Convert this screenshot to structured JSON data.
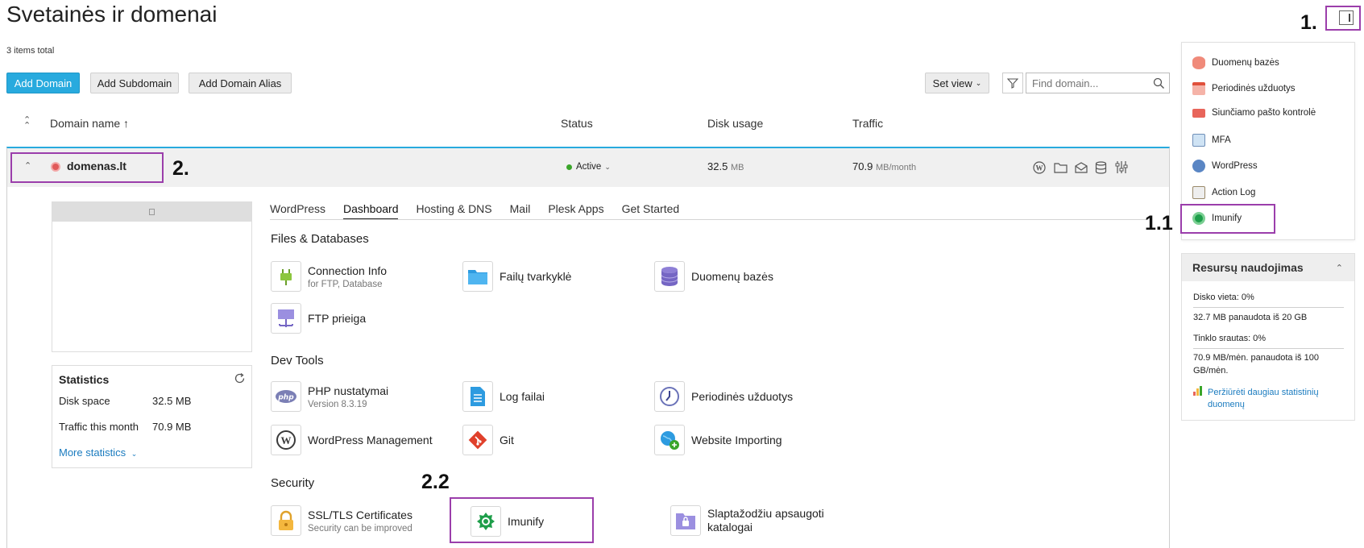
{
  "page": {
    "title": "Svetainės ir domenai",
    "items_total": "3 items total"
  },
  "toolbar": {
    "add_domain": "Add Domain",
    "add_subdomain": "Add Subdomain",
    "add_domain_alias": "Add Domain Alias",
    "set_view": "Set view",
    "search_placeholder": "Find domain..."
  },
  "table": {
    "headers": {
      "domain_name": "Domain name ↑",
      "status": "Status",
      "disk_usage": "Disk usage",
      "traffic": "Traffic"
    },
    "row": {
      "domain": "domenas.lt",
      "status": "Active",
      "disk_value": "32.5",
      "disk_unit": "MB",
      "traffic_value": "70.9",
      "traffic_unit": "MB/month"
    }
  },
  "tabs": [
    "WordPress",
    "Dashboard",
    "Hosting & DNS",
    "Mail",
    "Plesk Apps",
    "Get Started"
  ],
  "active_tab": "Dashboard",
  "sections": {
    "files": {
      "title": "Files & Databases",
      "tools": [
        {
          "name": "Connection Info",
          "sub": "for FTP, Database",
          "icon": "plug-icon"
        },
        {
          "name": "Failų tvarkyklė",
          "icon": "folder-icon"
        },
        {
          "name": "Duomenų bazės",
          "icon": "database-icon"
        },
        {
          "name": "FTP prieiga",
          "icon": "ftp-icon"
        }
      ]
    },
    "dev": {
      "title": "Dev Tools",
      "tools": [
        {
          "name": "PHP nustatymai",
          "sub": "Version 8.3.19",
          "icon": "php-icon"
        },
        {
          "name": "Log failai",
          "icon": "log-file-icon"
        },
        {
          "name": "Periodinės užduotys",
          "icon": "clock-icon"
        },
        {
          "name": "WordPress Management",
          "icon": "wordpress-icon"
        },
        {
          "name": "Git",
          "icon": "git-icon"
        },
        {
          "name": "Website Importing",
          "icon": "globe-import-icon"
        }
      ]
    },
    "security": {
      "title": "Security",
      "tools": [
        {
          "name": "SSL/TLS Certificates",
          "sub": "Security can be improved",
          "icon": "lock-icon"
        },
        {
          "name": "Imunify",
          "icon": "imunify-icon"
        },
        {
          "name": "Slaptažodžiu apsaugoti",
          "name2": "katalogai",
          "icon": "protected-folder-icon"
        }
      ]
    }
  },
  "statistics": {
    "title": "Statistics",
    "disk_label": "Disk space",
    "disk_value": "32.5 MB",
    "traffic_label": "Traffic this month",
    "traffic_value": "70.9 MB",
    "more": "More statistics"
  },
  "right_panel": {
    "menu": [
      "Duomenų bazės",
      "Periodinės užduotys",
      "Siunčiamo pašto kontrolė",
      "MFA",
      "WordPress",
      "Action Log",
      "Imunify"
    ],
    "resources": {
      "title": "Resursų naudojimas",
      "disk": "Disko vieta: 0%",
      "disk_detail": "32.7 MB panaudota iš 20 GB",
      "traffic": "Tinklo srautas: 0%",
      "traffic_detail_1": "70.9 MB/mėn. panaudota iš 100",
      "traffic_detail_2": "GB/mėn.",
      "link_1": "Peržiūrėti daugiau statistinių",
      "link_2": "duomenų"
    }
  },
  "callouts": {
    "c1": "1.",
    "c11": "1.1",
    "c2": "2.",
    "c22": "2.2"
  },
  "colors": {
    "accent": "#28aade",
    "highlight": "#9b3eab",
    "active": "#3aa52a",
    "link": "#1a7bbf"
  }
}
